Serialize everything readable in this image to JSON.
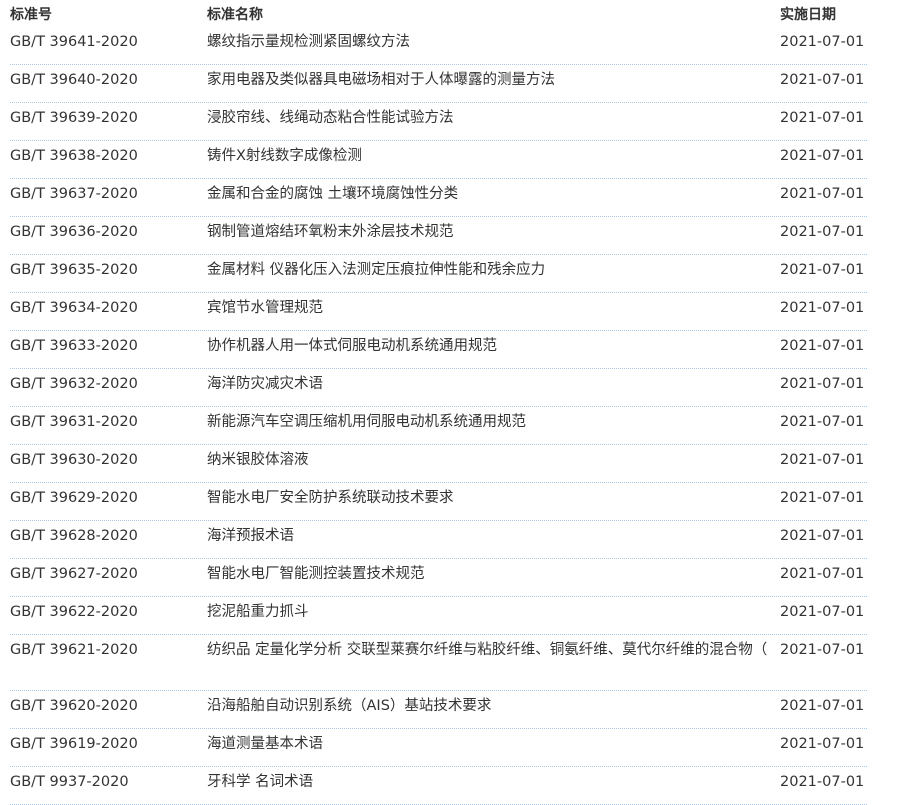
{
  "table": {
    "headers": {
      "code": "标准号",
      "name": "标准名称",
      "date": "实施日期"
    },
    "rows": [
      {
        "code": "GB/T 39641-2020",
        "name": "螺纹指示量规检测紧固螺纹方法",
        "date": "2021-07-01"
      },
      {
        "code": "GB/T 39640-2020",
        "name": "家用电器及类似器具电磁场相对于人体曝露的测量方法",
        "date": "2021-07-01"
      },
      {
        "code": "GB/T 39639-2020",
        "name": "浸胶帘线、线绳动态粘合性能试验方法",
        "date": "2021-07-01"
      },
      {
        "code": "GB/T 39638-2020",
        "name": "铸件X射线数字成像检测",
        "date": "2021-07-01"
      },
      {
        "code": "GB/T 39637-2020",
        "name": "金属和合金的腐蚀 土壤环境腐蚀性分类",
        "date": "2021-07-01"
      },
      {
        "code": "GB/T 39636-2020",
        "name": "钢制管道熔结环氧粉末外涂层技术规范",
        "date": "2021-07-01"
      },
      {
        "code": "GB/T 39635-2020",
        "name": "金属材料 仪器化压入法测定压痕拉伸性能和残余应力",
        "date": "2021-07-01"
      },
      {
        "code": "GB/T 39634-2020",
        "name": "宾馆节水管理规范",
        "date": "2021-07-01"
      },
      {
        "code": "GB/T 39633-2020",
        "name": "协作机器人用一体式伺服电动机系统通用规范",
        "date": "2021-07-01"
      },
      {
        "code": "GB/T 39632-2020",
        "name": "海洋防灾减灾术语",
        "date": "2021-07-01"
      },
      {
        "code": "GB/T 39631-2020",
        "name": "新能源汽车空调压缩机用伺服电动机系统通用规范",
        "date": "2021-07-01"
      },
      {
        "code": "GB/T 39630-2020",
        "name": "纳米银胶体溶液",
        "date": "2021-07-01"
      },
      {
        "code": "GB/T 39629-2020",
        "name": "智能水电厂安全防护系统联动技术要求",
        "date": "2021-07-01"
      },
      {
        "code": "GB/T 39628-2020",
        "name": "海洋预报术语",
        "date": "2021-07-01"
      },
      {
        "code": "GB/T 39627-2020",
        "name": "智能水电厂智能测控装置技术规范",
        "date": "2021-07-01"
      },
      {
        "code": "GB/T 39622-2020",
        "name": "挖泥船重力抓斗",
        "date": "2021-07-01"
      },
      {
        "code": "GB/T 39621-2020",
        "name": "纺织品 定量化学分析 交联型莱赛尔纤维与粘胶纤维、铜氨纤维、莫代尔纤维的混合物（",
        "date": "2021-07-01"
      },
      {
        "code": "GB/T 39620-2020",
        "name": "沿海船舶自动识别系统（AIS）基站技术要求",
        "date": "2021-07-01"
      },
      {
        "code": "GB/T 39619-2020",
        "name": "海道测量基本术语",
        "date": "2021-07-01"
      },
      {
        "code": "GB/T 9937-2020",
        "name": "牙科学 名词术语",
        "date": "2021-07-01"
      }
    ]
  }
}
